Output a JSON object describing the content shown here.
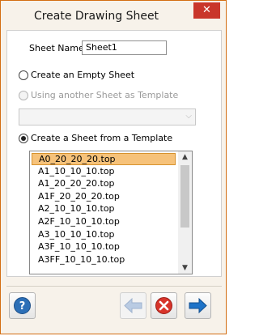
{
  "window": {
    "title": "Create Drawing Sheet",
    "close_glyph": "✕"
  },
  "form": {
    "sheet_name_label": "Sheet Name:",
    "sheet_name_value": "Sheet1",
    "option_empty": "Create an Empty Sheet",
    "option_template_sheet": "Using another Sheet as Template",
    "option_from_template": "Create a Sheet from a Template",
    "selected_option": "option_from_template"
  },
  "templates": {
    "items": [
      "A0_20_20_20.top",
      "A1_10_10_10.top",
      "A1_20_20_20.top",
      "A1F_20_20_20.top",
      "A2_10_10_10.top",
      "A2F_10_10_10.top",
      "A3_10_10_10.top",
      "A3F_10_10_10.top",
      "A3FF_10_10_10.top"
    ],
    "selected_index": 0
  },
  "footer": {
    "help_icon": "help-icon",
    "back_icon": "back-arrow-icon",
    "cancel_icon": "cancel-icon",
    "next_icon": "next-arrow-icon"
  },
  "colors": {
    "selection": "#f6c27a",
    "close_button": "#c9362b",
    "accent_blue": "#1e73c8"
  }
}
